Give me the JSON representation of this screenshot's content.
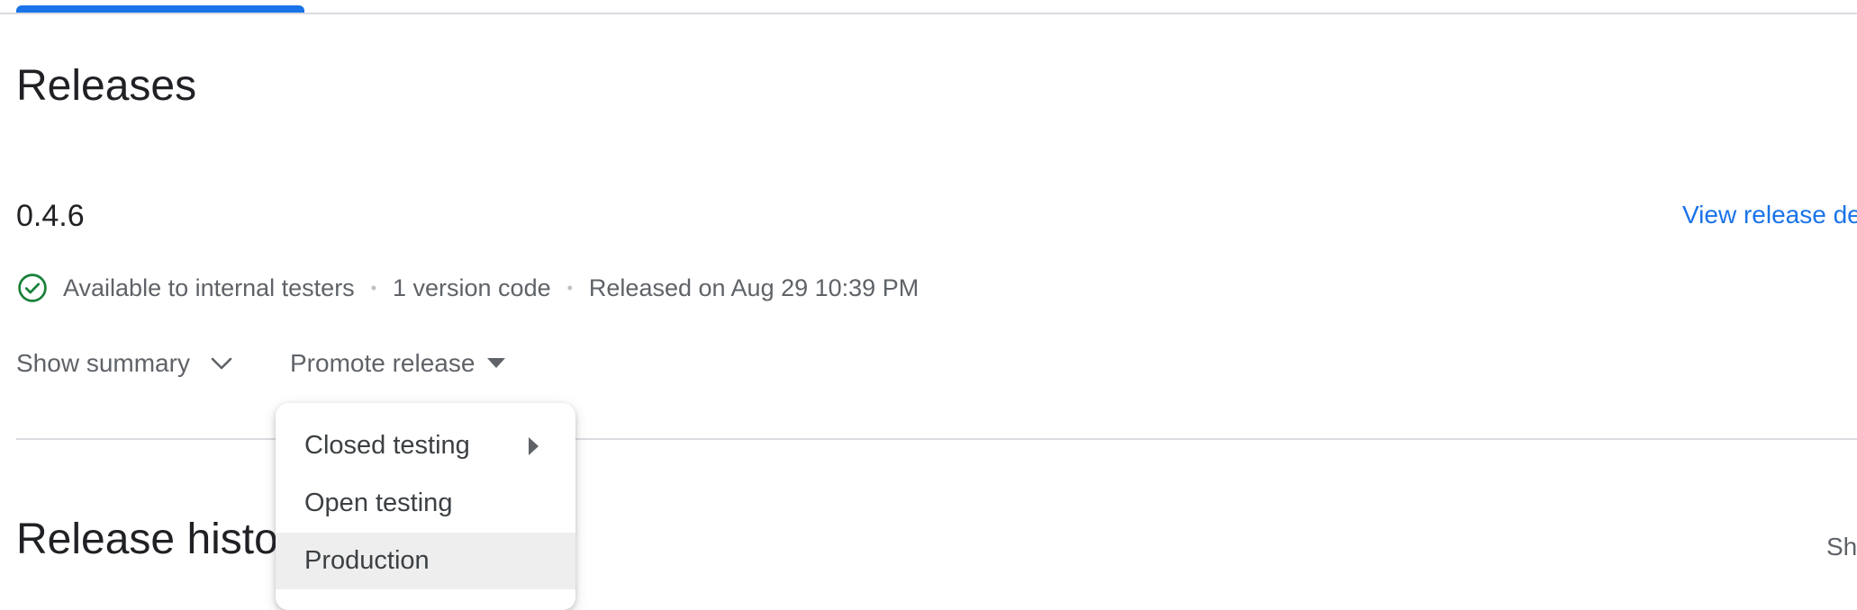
{
  "page": {
    "title": "Releases"
  },
  "release": {
    "version": "0.4.6",
    "view_details_label": "View release de",
    "status": {
      "icon": "check-circle-icon",
      "label": "Available to internal testers"
    },
    "version_code_text": "1 version code",
    "released_on_text": "Released on Aug 29 10:39 PM",
    "separator_glyph": "•",
    "show_summary_label": "Show summary",
    "promote_label": "Promote release"
  },
  "promote_menu": {
    "items": [
      {
        "label": "Closed testing",
        "has_submenu": true
      },
      {
        "label": "Open testing",
        "has_submenu": false
      },
      {
        "label": "Production",
        "has_submenu": false,
        "highlighted": true
      }
    ]
  },
  "history": {
    "title": "Release histo",
    "right_clipped_text": "Sh"
  },
  "colors": {
    "accent": "#1a73e8",
    "success": "#188038",
    "text_primary": "#202124",
    "text_secondary": "#5f6368",
    "divider": "#dadce0",
    "menu_highlight": "#eeeeee"
  }
}
